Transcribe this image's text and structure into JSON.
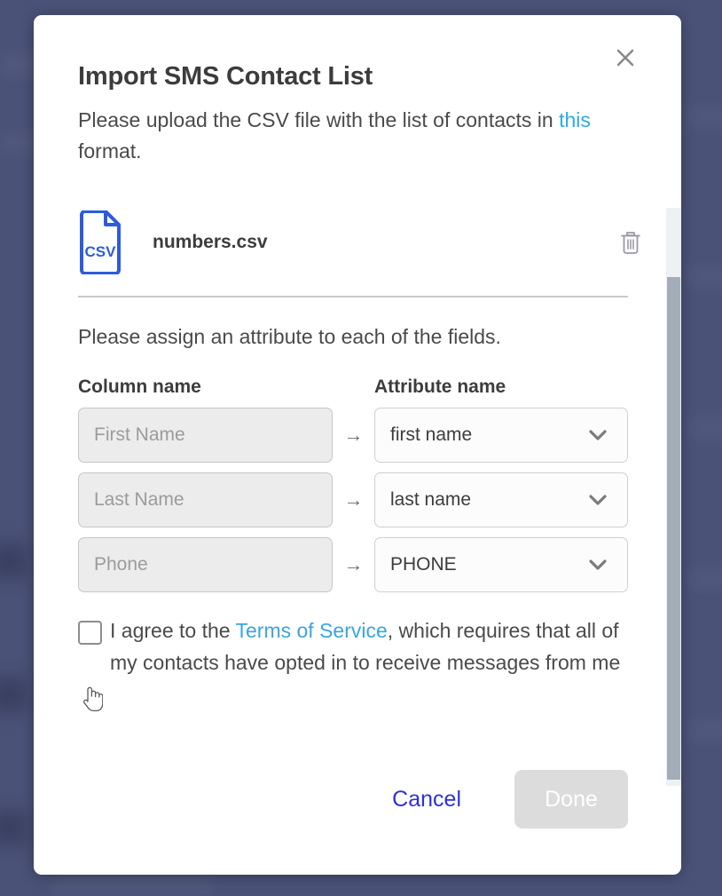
{
  "modal": {
    "title": "Import SMS Contact List",
    "subtitle_before": "Please upload the CSV file with the list of contacts in ",
    "subtitle_link": "this",
    "subtitle_after": " format.",
    "close_icon": "close-icon"
  },
  "file": {
    "icon_label": "CSV",
    "name": "numbers.csv",
    "delete_icon": "trash-icon"
  },
  "assign": {
    "instruction": "Please assign an attribute to each of the fields.",
    "column_header": "Column name",
    "attribute_header": "Attribute name",
    "arrow": "→",
    "rows": [
      {
        "column_placeholder": "First Name",
        "attribute_value": "first name"
      },
      {
        "column_placeholder": "Last Name",
        "attribute_value": "last name"
      },
      {
        "column_placeholder": "Phone",
        "attribute_value": "PHONE"
      }
    ]
  },
  "agreement": {
    "checked": false,
    "text_before": "I agree to the ",
    "link": "Terms of Service",
    "text_after": ", which requires that all of my contacts have opted in to receive messages from me"
  },
  "footer": {
    "cancel_label": "Cancel",
    "done_label": "Done"
  },
  "colors": {
    "backdrop": "#4b5278",
    "link_light": "#2aabe3",
    "link_tos": "#3aa5dd",
    "cancel": "#2f2fe0",
    "csv_icon": "#2e5bdc",
    "done_bg": "#dcdcdc"
  }
}
